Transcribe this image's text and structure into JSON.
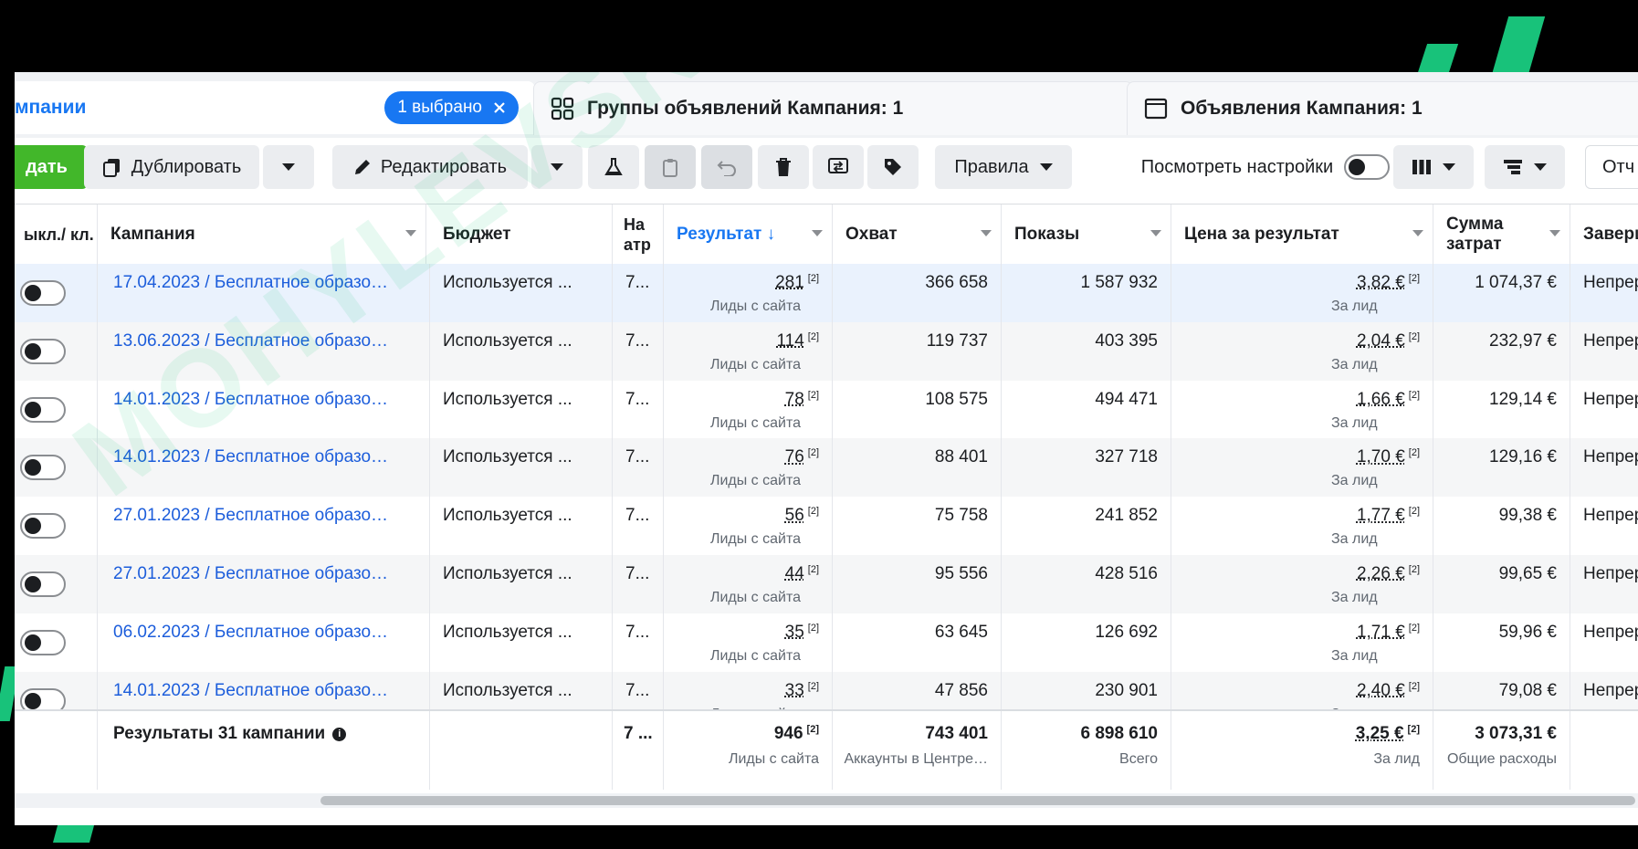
{
  "tabs": {
    "campaigns_label": "мпании",
    "selected_badge": "1 выбрано",
    "adsets_label": "Группы объявлений Кампания: 1",
    "ads_label": "Объявления Кампания: 1"
  },
  "toolbar": {
    "create_label": "дать",
    "duplicate_label": "Дублировать",
    "edit_label": "Редактировать",
    "rules_label": "Правила",
    "view_settings_label": "Посмотреть настройки",
    "reports_label": "Отч"
  },
  "columns": {
    "toggle": "ыкл./ кл.",
    "campaign": "Кампания",
    "budget": "Бюджет",
    "attribution": "На атр",
    "result": "Результат ↓",
    "reach": "Охват",
    "impressions": "Показы",
    "cost": "Цена за результат",
    "spend": "Сумма затрат",
    "ends": "Заверш"
  },
  "rows": [
    {
      "campaign": "17.04.2023 / Бесплатное образо…",
      "budget": "Используется ...",
      "attr": "7...",
      "result": "281",
      "result_sup": "[2]",
      "result_sub": "Лиды с сайта",
      "reach": "366 658",
      "impressions": "1 587 932",
      "cost": "3,82 €",
      "cost_sup": "[2]",
      "cost_sub": "За лид",
      "spend": "1 074,37 €",
      "ends": "Непреры"
    },
    {
      "campaign": "13.06.2023 / Бесплатное образо…",
      "budget": "Используется ...",
      "attr": "7...",
      "result": "114",
      "result_sup": "[2]",
      "result_sub": "Лиды с сайта",
      "reach": "119 737",
      "impressions": "403 395",
      "cost": "2,04 €",
      "cost_sup": "[2]",
      "cost_sub": "За лид",
      "spend": "232,97 €",
      "ends": "Непреры"
    },
    {
      "campaign": "14.01.2023 / Бесплатное образо…",
      "budget": "Используется ...",
      "attr": "7...",
      "result": "78",
      "result_sup": "[2]",
      "result_sub": "Лиды с сайта",
      "reach": "108 575",
      "impressions": "494 471",
      "cost": "1,66 €",
      "cost_sup": "[2]",
      "cost_sub": "За лид",
      "spend": "129,14 €",
      "ends": "Непреры"
    },
    {
      "campaign": "14.01.2023 / Бесплатное образо…",
      "budget": "Используется ...",
      "attr": "7...",
      "result": "76",
      "result_sup": "[2]",
      "result_sub": "Лиды с сайта",
      "reach": "88 401",
      "impressions": "327 718",
      "cost": "1,70 €",
      "cost_sup": "[2]",
      "cost_sub": "За лид",
      "spend": "129,16 €",
      "ends": "Непреры"
    },
    {
      "campaign": "27.01.2023 / Бесплатное образо…",
      "budget": "Используется ...",
      "attr": "7...",
      "result": "56",
      "result_sup": "[2]",
      "result_sub": "Лиды с сайта",
      "reach": "75 758",
      "impressions": "241 852",
      "cost": "1,77 €",
      "cost_sup": "[2]",
      "cost_sub": "За лид",
      "spend": "99,38 €",
      "ends": "Непреры"
    },
    {
      "campaign": "27.01.2023 / Бесплатное образо…",
      "budget": "Используется ...",
      "attr": "7...",
      "result": "44",
      "result_sup": "[2]",
      "result_sub": "Лиды с сайта",
      "reach": "95 556",
      "impressions": "428 516",
      "cost": "2,26 €",
      "cost_sup": "[2]",
      "cost_sub": "За лид",
      "spend": "99,65 €",
      "ends": "Непреры"
    },
    {
      "campaign": "06.02.2023 / Бесплатное образо…",
      "budget": "Используется ...",
      "attr": "7...",
      "result": "35",
      "result_sup": "[2]",
      "result_sub": "Лиды с сайта",
      "reach": "63 645",
      "impressions": "126 692",
      "cost": "1,71 €",
      "cost_sup": "[2]",
      "cost_sub": "За лид",
      "spend": "59,96 €",
      "ends": "Непреры"
    },
    {
      "campaign": "14.01.2023 / Бесплатное образо…",
      "budget": "Используется ...",
      "attr": "7...",
      "result": "33",
      "result_sup": "[2]",
      "result_sub": "Лиды с сайта",
      "reach": "47 856",
      "impressions": "230 901",
      "cost": "2,40 €",
      "cost_sup": "[2]",
      "cost_sub": "За лид",
      "spend": "79,08 €",
      "ends": "Непреры"
    }
  ],
  "summary": {
    "label": "Результаты 31 кампании",
    "attr": "7 ...",
    "result": "946",
    "result_sup": "[2]",
    "result_sub": "Лиды с сайта",
    "reach": "743 401",
    "reach_sub": "Аккаунты в Центре…",
    "impressions": "6 898 610",
    "impressions_sub": "Всего",
    "cost": "3,25 €",
    "cost_sup": "[2]",
    "cost_sub": "За лид",
    "spend": "3 073,31 €",
    "spend_sub": "Общие расходы"
  },
  "watermark": "MOHYLEVSKYI.DIGITAL"
}
